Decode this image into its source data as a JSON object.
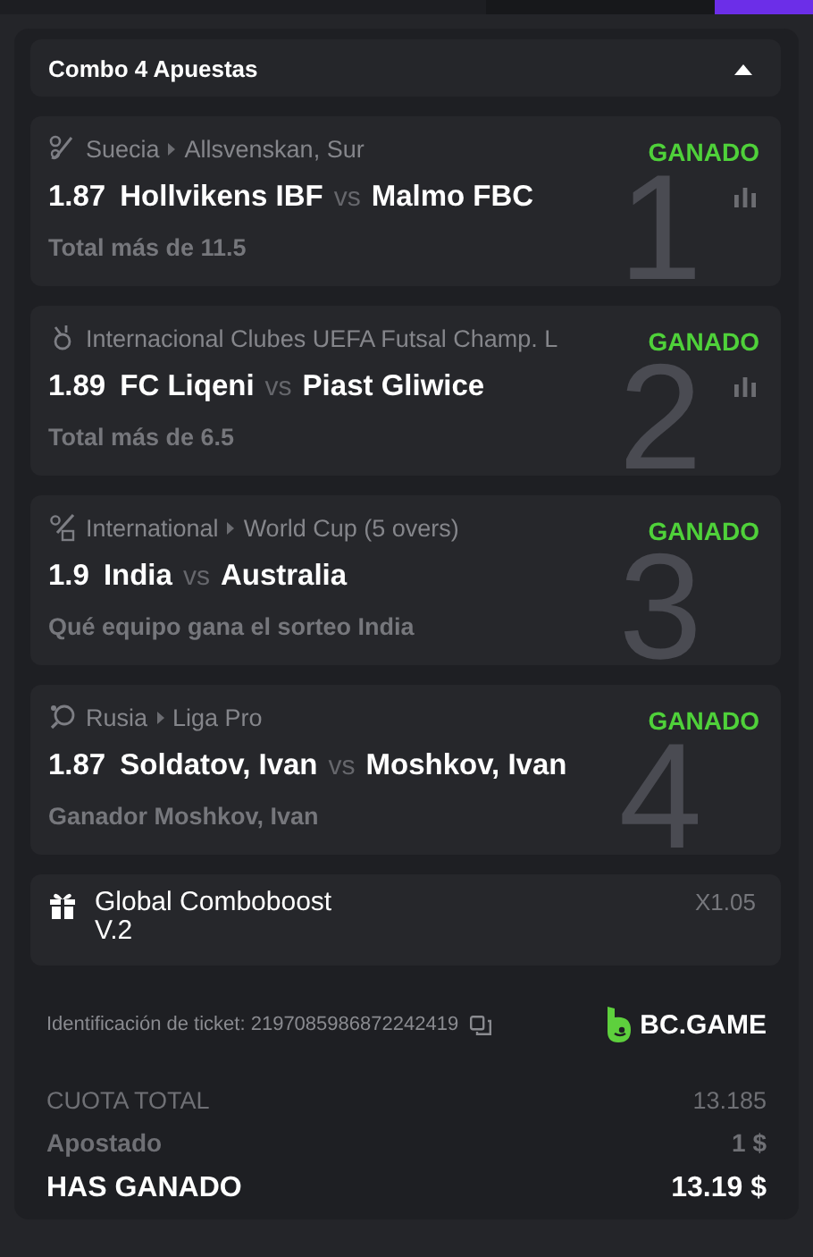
{
  "bet_slip": {
    "title": "Combo 4 Apuestas",
    "expanded": true,
    "legs": [
      {
        "number": "1",
        "kind": "floorball",
        "country": "Suecia",
        "league": "Allsvenskan, Sur",
        "status": "GANADO",
        "odds": "1.87",
        "home": "Hollvikens IBF",
        "vs": "vs",
        "away": "Malmo FBC",
        "market": "Total más de 11.5",
        "stats": true
      },
      {
        "number": "2",
        "kind": "futsal",
        "country": "Internacional Clubes UEFA Futsal Champ. L",
        "status": "GANADO",
        "odds": "1.89",
        "home": "FC Liqeni",
        "vs": "vs",
        "away": "Piast Gliwice",
        "market": "Total más de 6.5",
        "stats": true
      },
      {
        "number": "3",
        "kind": "cricket",
        "country": "International",
        "league": "World Cup (5 overs)",
        "status": "GANADO",
        "odds": "1.9",
        "home": "India",
        "vs": "vs",
        "away": "Australia",
        "market": "Qué equipo gana el sorteo India",
        "stats": false
      },
      {
        "number": "4",
        "kind": "paddle",
        "country": "Rusia",
        "league": "Liga Pro",
        "status": "GANADO",
        "odds": "1.87",
        "home": "Soldatov, Ivan",
        "vs": "vs",
        "away": "Moshkov, Ivan",
        "market": "Ganador Moshkov, Ivan",
        "stats": false
      }
    ],
    "boost": {
      "title": "Global Comboboost V.2",
      "multiplier": "X1.05"
    },
    "ticket_id": "Identificación de ticket: 2197085986872242419",
    "logo": "BC.GAME",
    "totals": [
      {
        "kind": "odds",
        "label": "CUOTA TOTAL",
        "value": "13.185"
      },
      {
        "kind": "stake",
        "label": "Apostado",
        "value": "1 $"
      },
      {
        "kind": "win",
        "label": "HAS GANADO",
        "value": "13.19 $"
      }
    ]
  }
}
